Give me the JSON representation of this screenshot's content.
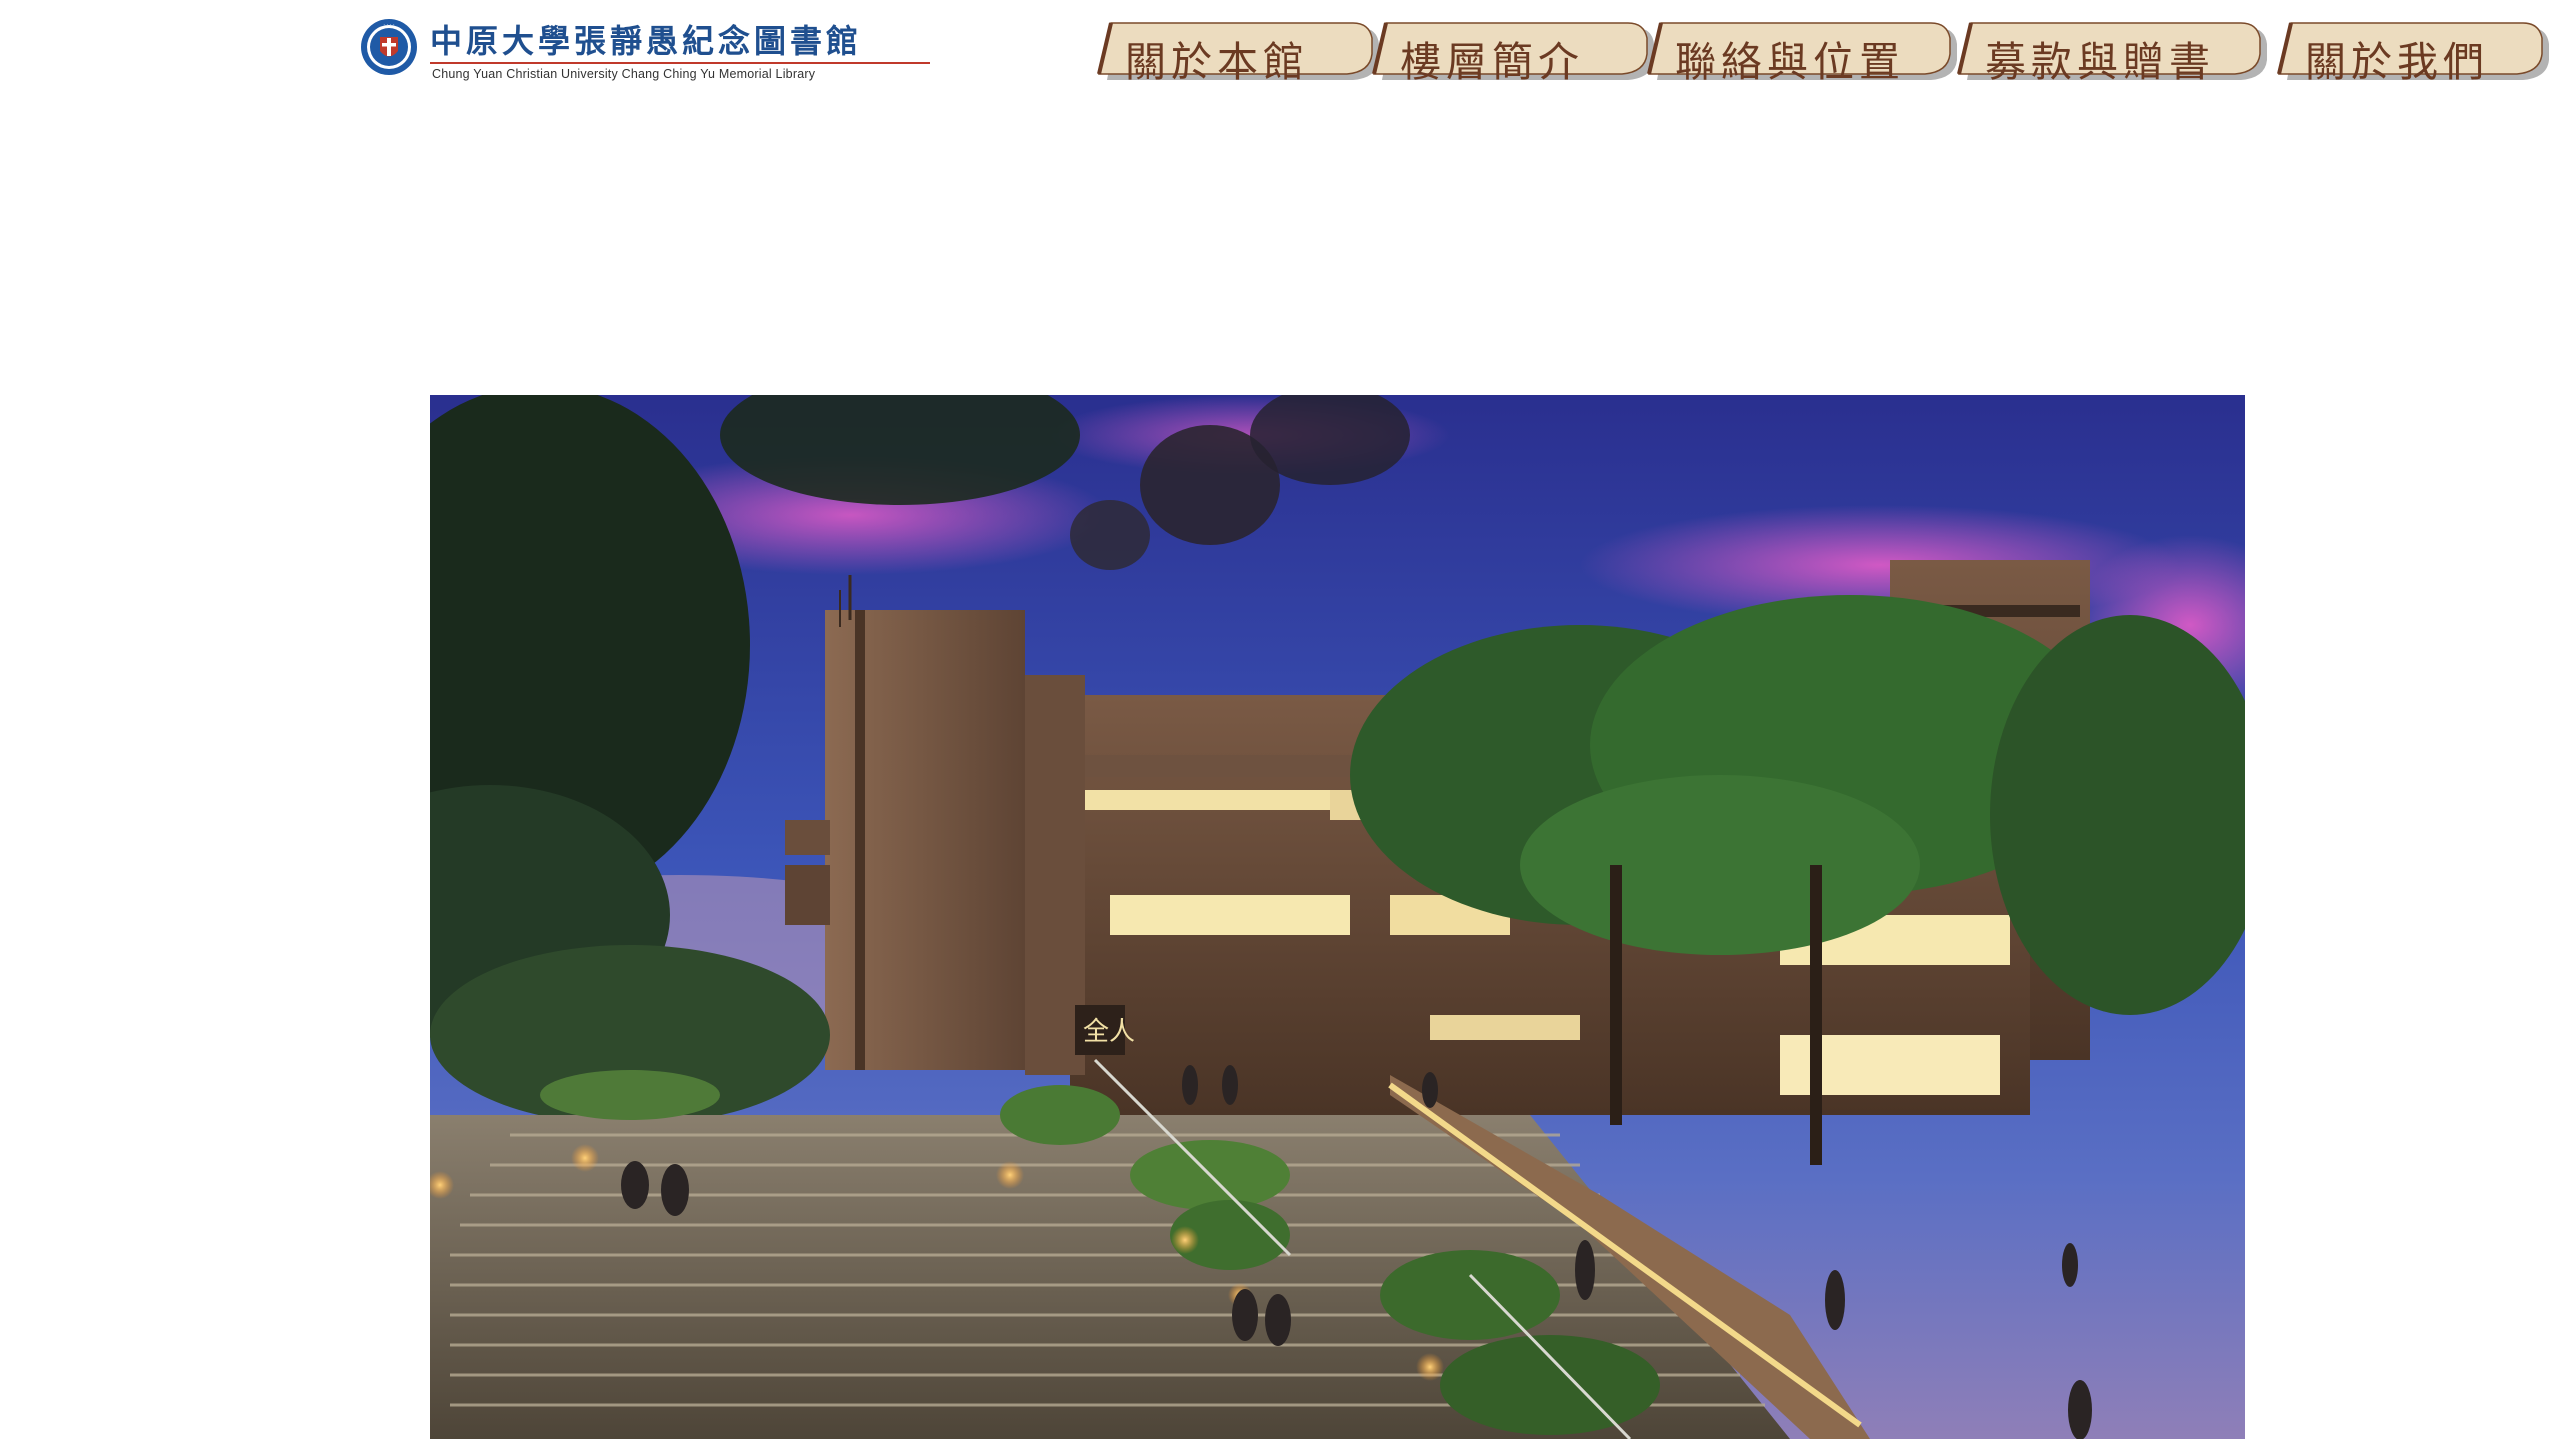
{
  "header": {
    "logo": {
      "name_zh": "中原大學張靜愚紀念圖書館",
      "name_en": "Chung Yuan Christian University Chang Ching Yu Memorial Library",
      "emblem_icon": "university-emblem-icon"
    },
    "nav": [
      {
        "label": "關於本館"
      },
      {
        "label": "樓層簡介"
      },
      {
        "label": "聯絡與位置"
      },
      {
        "label": "募款與贈書"
      },
      {
        "label": "關於我們"
      }
    ]
  },
  "main": {
    "hero_image": "library-building-night-photo"
  },
  "colors": {
    "tab_fill": "#ecdcbf",
    "tab_text": "#6b3a22",
    "tab_shadow": "#9a9a9a",
    "logo_blue": "#1f4f8f",
    "logo_red": "#c0392b"
  }
}
